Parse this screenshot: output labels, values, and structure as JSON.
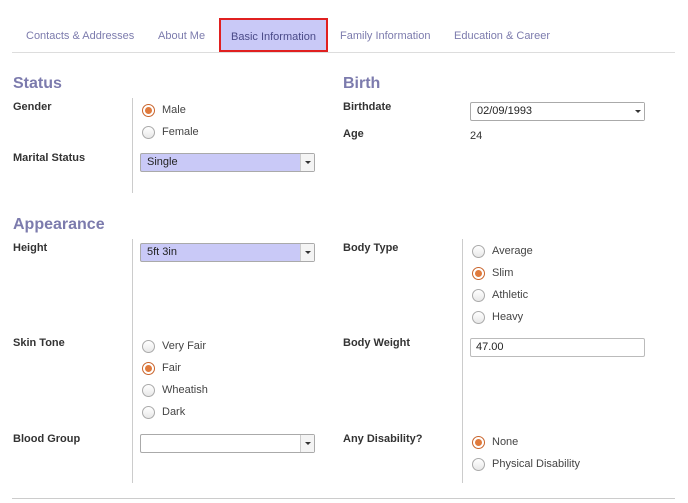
{
  "tabs": [
    {
      "label": "Contacts & Addresses"
    },
    {
      "label": "About Me"
    },
    {
      "label": "Basic Information"
    },
    {
      "label": "Family Information"
    },
    {
      "label": "Education & Career"
    }
  ],
  "status": {
    "title": "Status",
    "gender_label": "Gender",
    "gender_options": [
      "Male",
      "Female"
    ],
    "gender_selected": "Male",
    "marital_label": "Marital Status",
    "marital_value": "Single"
  },
  "birth": {
    "title": "Birth",
    "birthdate_label": "Birthdate",
    "birthdate_value": "02/09/1993",
    "age_label": "Age",
    "age_value": "24"
  },
  "appearance": {
    "title": "Appearance",
    "height_label": "Height",
    "height_value": "5ft 3in",
    "body_type_label": "Body Type",
    "body_type_options": [
      "Average",
      "Slim",
      "Athletic",
      "Heavy"
    ],
    "body_type_selected": "Slim",
    "skin_tone_label": "Skin Tone",
    "skin_tone_options": [
      "Very Fair",
      "Fair",
      "Wheatish",
      "Dark"
    ],
    "skin_tone_selected": "Fair",
    "body_weight_label": "Body Weight",
    "body_weight_value": "47.00",
    "blood_group_label": "Blood Group",
    "blood_group_value": "",
    "disability_label": "Any Disability?",
    "disability_options": [
      "None",
      "Physical Disability"
    ],
    "disability_selected": "None"
  },
  "colors": {
    "accent": "#7c7bad",
    "active_tab_bg": "#c9c9f7",
    "highlight_border": "#e02020",
    "radio_checked": "#e07a3c"
  }
}
